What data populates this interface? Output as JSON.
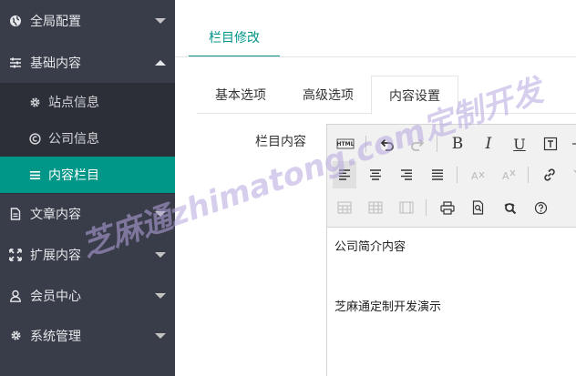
{
  "sidebar": {
    "items": [
      {
        "label": "全局配置",
        "icon": "globe-icon"
      },
      {
        "label": "基础内容",
        "icon": "sliders-icon"
      },
      {
        "label": "文章内容",
        "icon": "file-icon"
      },
      {
        "label": "扩展内容",
        "icon": "expand-icon"
      },
      {
        "label": "会员中心",
        "icon": "user-icon"
      },
      {
        "label": "系统管理",
        "icon": "gear-icon"
      }
    ],
    "sub_items": [
      {
        "label": "站点信息",
        "icon": "gear-icon"
      },
      {
        "label": "公司信息",
        "icon": "copyright-icon"
      },
      {
        "label": "内容栏目",
        "icon": "list-icon"
      }
    ]
  },
  "main": {
    "top_tab": "栏目修改",
    "tabs": [
      "基本选项",
      "高级选项",
      "内容设置"
    ],
    "field_label": "栏目内容",
    "editor": {
      "html_button": "HTML",
      "bold": "B",
      "italic": "I",
      "underline": "U",
      "content": [
        "公司简介内容",
        "",
        "芝麻通定制开发演示"
      ]
    }
  },
  "watermark": "芝麻通zhimatong.com定制开发",
  "colors": {
    "sidebar": "#393d49",
    "submenu": "#2c2f38",
    "accent": "#009688"
  }
}
